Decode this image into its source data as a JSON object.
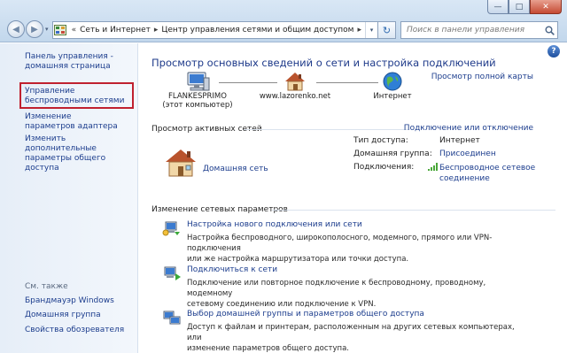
{
  "window": {
    "min_glyph": "—",
    "max_glyph": "□",
    "close_glyph": "✕"
  },
  "address": {
    "chevrons": "«",
    "parts": [
      "Сеть и Интернет",
      "Центр управления сетями и общим доступом"
    ],
    "separator": "▸",
    "dropdown_glyph": "▾",
    "refresh_glyph": "↻"
  },
  "nav": {
    "back_glyph": "◀",
    "forward_glyph": "▶",
    "history_glyph": "▾"
  },
  "search": {
    "placeholder": "Поиск в панели управления"
  },
  "sidebar": {
    "items": [
      {
        "label": "Панель управления - домашняя страница"
      },
      {
        "label": "Управление беспроводными сетями"
      },
      {
        "label": "Изменение параметров адаптера"
      },
      {
        "label": "Изменить дополнительные параметры общего доступа"
      }
    ],
    "see_also_title": "См. также",
    "see_also": [
      {
        "label": "Брандмауэр Windows"
      },
      {
        "label": "Домашняя группа"
      },
      {
        "label": "Свойства обозревателя"
      }
    ]
  },
  "main": {
    "help": "?",
    "title": "Просмотр основных сведений о сети и настройка подключений",
    "full_map": "Просмотр полной карты",
    "map": {
      "computer_name": "FLANKESPRIMO",
      "computer_sub": "(этот компьютер)",
      "network_name": "www.lazorenko.net",
      "internet": "Интернет"
    },
    "active_header": "Просмотр активных сетей",
    "connect_link": "Подключение или отключение",
    "network": {
      "name": "Домашняя сеть",
      "access_label": "Тип доступа:",
      "access_value": "Интернет",
      "homegroup_label": "Домашняя группа:",
      "homegroup_value": "Присоединен",
      "connections_label": "Подключения:",
      "connection_value_1": "Беспроводное сетевое",
      "connection_value_2": "соединение"
    },
    "change_header": "Изменение сетевых параметров",
    "tasks": [
      {
        "title": "Настройка нового подключения или сети",
        "desc1": "Настройка беспроводного, широкополосного, модемного, прямого или VPN-подключения",
        "desc2": "или же настройка маршрутизатора или точки доступа."
      },
      {
        "title": "Подключиться к сети",
        "desc1": "Подключение или повторное подключение к беспроводному, проводному, модемному",
        "desc2": "сетевому соединению или подключение к VPN."
      },
      {
        "title": "Выбор домашней группы и параметров общего доступа",
        "desc1": "Доступ к файлам и принтерам, расположенным на других сетевых компьютерах, или",
        "desc2": "изменение параметров общего доступа."
      }
    ]
  },
  "colors": {
    "link": "#1c3d8d",
    "title": "#1e3a8a",
    "highlight_border": "#c0212f",
    "chrome": "#c2d7ec"
  }
}
